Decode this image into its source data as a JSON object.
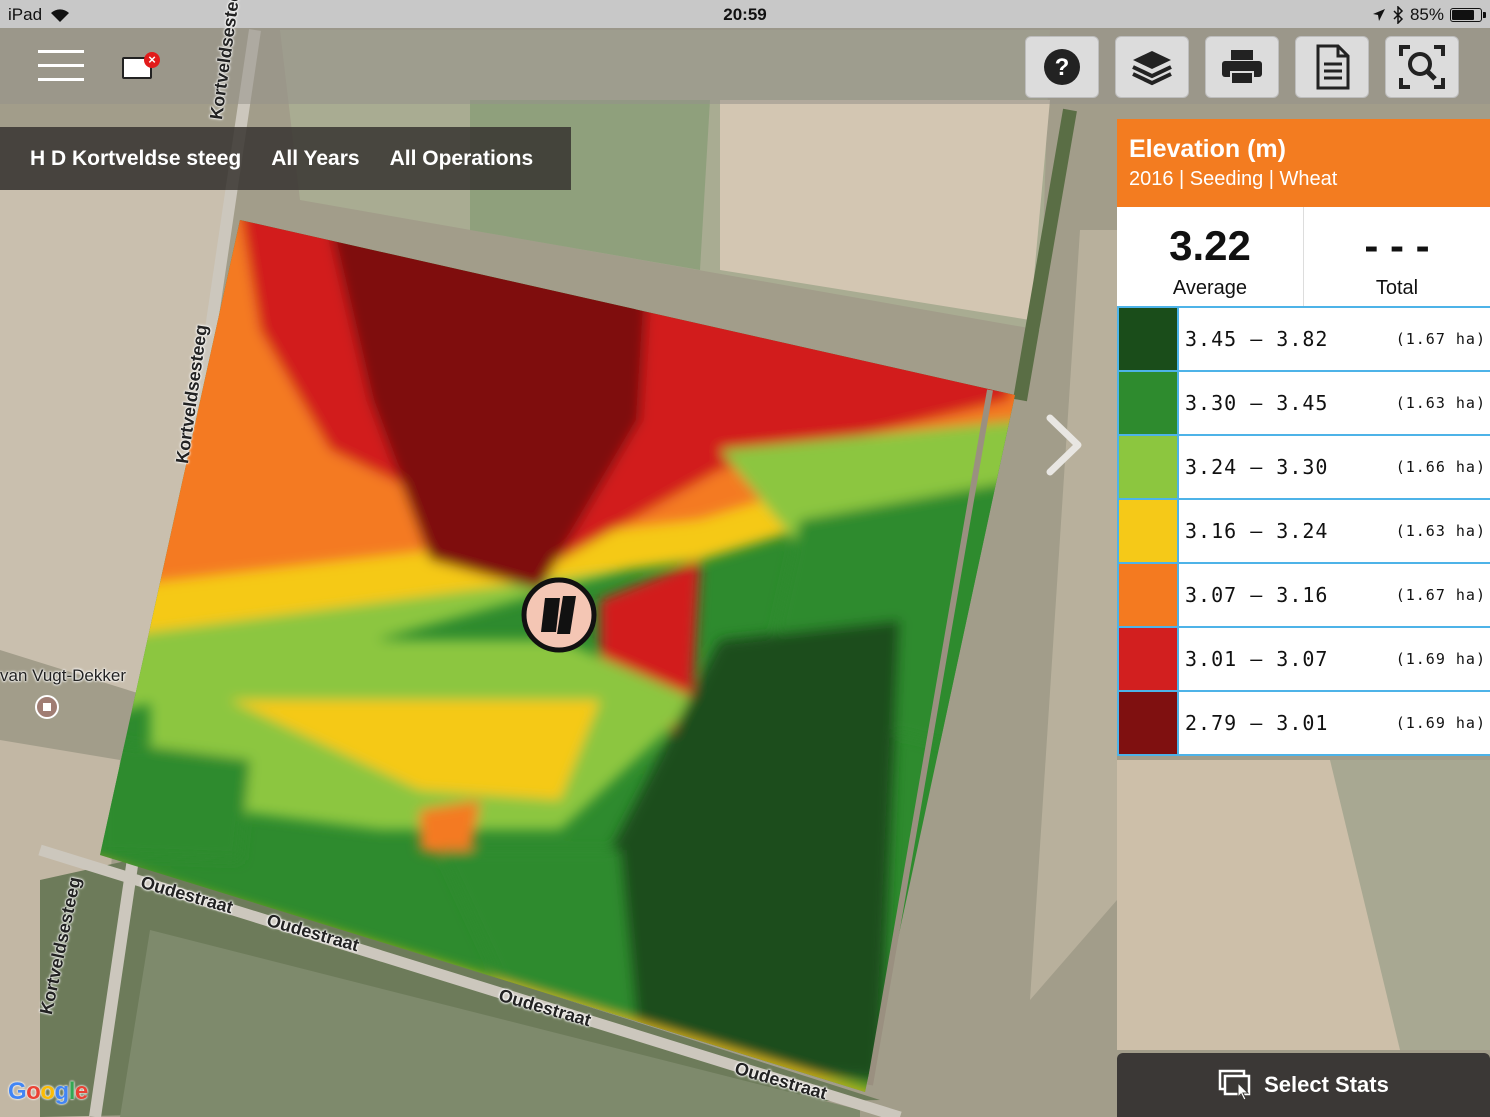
{
  "status_bar": {
    "device": "iPad",
    "time": "20:59",
    "battery": "85%",
    "battery_level": 0.85
  },
  "toolbar": {
    "buttons": [
      "help-icon",
      "layers-icon",
      "print-icon",
      "document-icon",
      "zoom-extent-icon"
    ]
  },
  "breadcrumb": {
    "field": "H D Kortveldse steeg",
    "years": "All Years",
    "operations": "All Operations"
  },
  "map": {
    "road_labels": {
      "kortveldsesteeg_1": "Kortveldsesteeg",
      "kortveldsesteeg_2": "Kortveldsesteeg",
      "kortveldsesteeg_3": "Kortveldsesteeg",
      "oudestraat_1": "Oudestraat",
      "oudestraat_2": "Oudestraat",
      "oudestraat_3": "Oudestraat",
      "oudestraat_4": "Oudestraat"
    },
    "poi": "van Vugt-Dekker",
    "attribution_logo": "Google",
    "field_colors": [
      "#1a4d1a",
      "#2e8b2e",
      "#8cc63f",
      "#f5c918",
      "#f47a20",
      "#d21f1f",
      "#7f1010"
    ]
  },
  "legend": {
    "title": "Elevation (m)",
    "subtitle": "2016 | Seeding | Wheat",
    "average_value": "3.22",
    "average_label": "Average",
    "total_value": "- - -",
    "total_label": "Total",
    "rows": [
      {
        "color": "#1a4d1a",
        "range": "3.45 – 3.82",
        "area": "(1.67 ha)"
      },
      {
        "color": "#2e8b2e",
        "range": "3.30 – 3.45",
        "area": "(1.63 ha)"
      },
      {
        "color": "#8cc63f",
        "range": "3.24 – 3.30",
        "area": "(1.66 ha)"
      },
      {
        "color": "#f5c918",
        "range": "3.16 – 3.24",
        "area": "(1.63 ha)"
      },
      {
        "color": "#f47a20",
        "range": "3.07 – 3.16",
        "area": "(1.67 ha)"
      },
      {
        "color": "#d21f1f",
        "range": "3.01 – 3.07",
        "area": "(1.69 ha)"
      },
      {
        "color": "#7f1010",
        "range": "2.79 – 3.01",
        "area": "(1.69 ha)"
      }
    ]
  },
  "select_stats": {
    "label": "Select Stats"
  }
}
